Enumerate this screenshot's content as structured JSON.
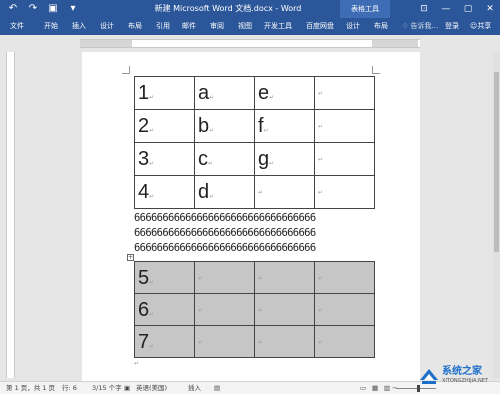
{
  "titlebar": {
    "undo_icon": "undo-icon",
    "redo_icon": "redo-icon",
    "title": "新建 Microsoft Word 文档.docx - Word",
    "context_tab": "表格工具",
    "color": "#2b579a"
  },
  "ribbon": {
    "tabs": [
      "文件",
      "开始",
      "插入",
      "设计",
      "布局",
      "引用",
      "邮件",
      "审阅",
      "视图",
      "开发工具",
      "百度网盘",
      "设计",
      "布局"
    ],
    "tell_me": "告诉我...",
    "signin": "登录",
    "share": "共享"
  },
  "table1": [
    [
      "1",
      "a",
      "e",
      ""
    ],
    [
      "2",
      "b",
      "f",
      ""
    ],
    [
      "3",
      "c",
      "g",
      ""
    ],
    [
      "4",
      "d",
      "",
      ""
    ]
  ],
  "paragraph": {
    "lines": [
      "66666666666666666666666666666666",
      "66666666666666666666666666666666",
      "66666666666666666666666666666666"
    ]
  },
  "table2": [
    [
      "5",
      "",
      "",
      ""
    ],
    [
      "6",
      "",
      "",
      ""
    ],
    [
      "7",
      "",
      "",
      ""
    ]
  ],
  "status": {
    "page": "第 1 页，共 1 页",
    "row": "行: 6",
    "words": "3/15 个字",
    "language": "英语(美国)",
    "mode": "插入"
  },
  "watermark": {
    "name": "系统之家",
    "url": "XITONGZHIJIA.NET"
  }
}
